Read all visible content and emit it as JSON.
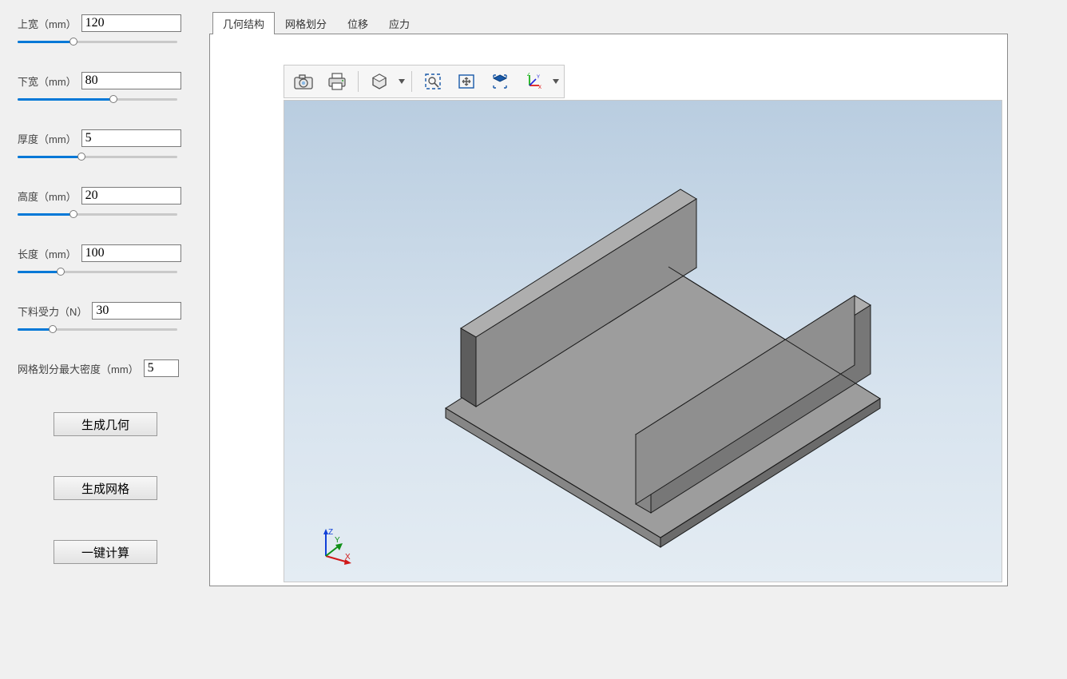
{
  "sidebar": {
    "params": [
      {
        "label": "上宽（mm）",
        "value": "120",
        "fillPct": 35
      },
      {
        "label": "下宽（mm）",
        "value": "80",
        "fillPct": 60
      },
      {
        "label": "厚度（mm）",
        "value": "5",
        "fillPct": 40
      },
      {
        "label": "高度（mm）",
        "value": "20",
        "fillPct": 35
      },
      {
        "label": "长度（mm）",
        "value": "100",
        "fillPct": 27
      },
      {
        "label": "下料受力（N）",
        "value": "30",
        "fillPct": 22
      }
    ],
    "meshParam": {
      "label": "网格划分最大密度（mm）",
      "value": "5"
    },
    "buttons": {
      "genGeom": "生成几何",
      "genMesh": "生成网格",
      "calcAll": "一键计算"
    }
  },
  "tabs": {
    "items": [
      {
        "label": "几何结构",
        "active": true
      },
      {
        "label": "网格划分",
        "active": false
      },
      {
        "label": "位移",
        "active": false
      },
      {
        "label": "应力",
        "active": false
      }
    ]
  },
  "toolbar": {
    "icons": {
      "snapshot": "snapshot-icon",
      "print": "print-icon",
      "render": "render-mode-icon",
      "zoomSelect": "zoom-selection-icon",
      "fit": "zoom-fit-icon",
      "isometric": "isometric-view-icon",
      "axisView": "axis-triad-icon"
    }
  },
  "triad": {
    "x": "X",
    "y": "Y",
    "z": "Z"
  }
}
